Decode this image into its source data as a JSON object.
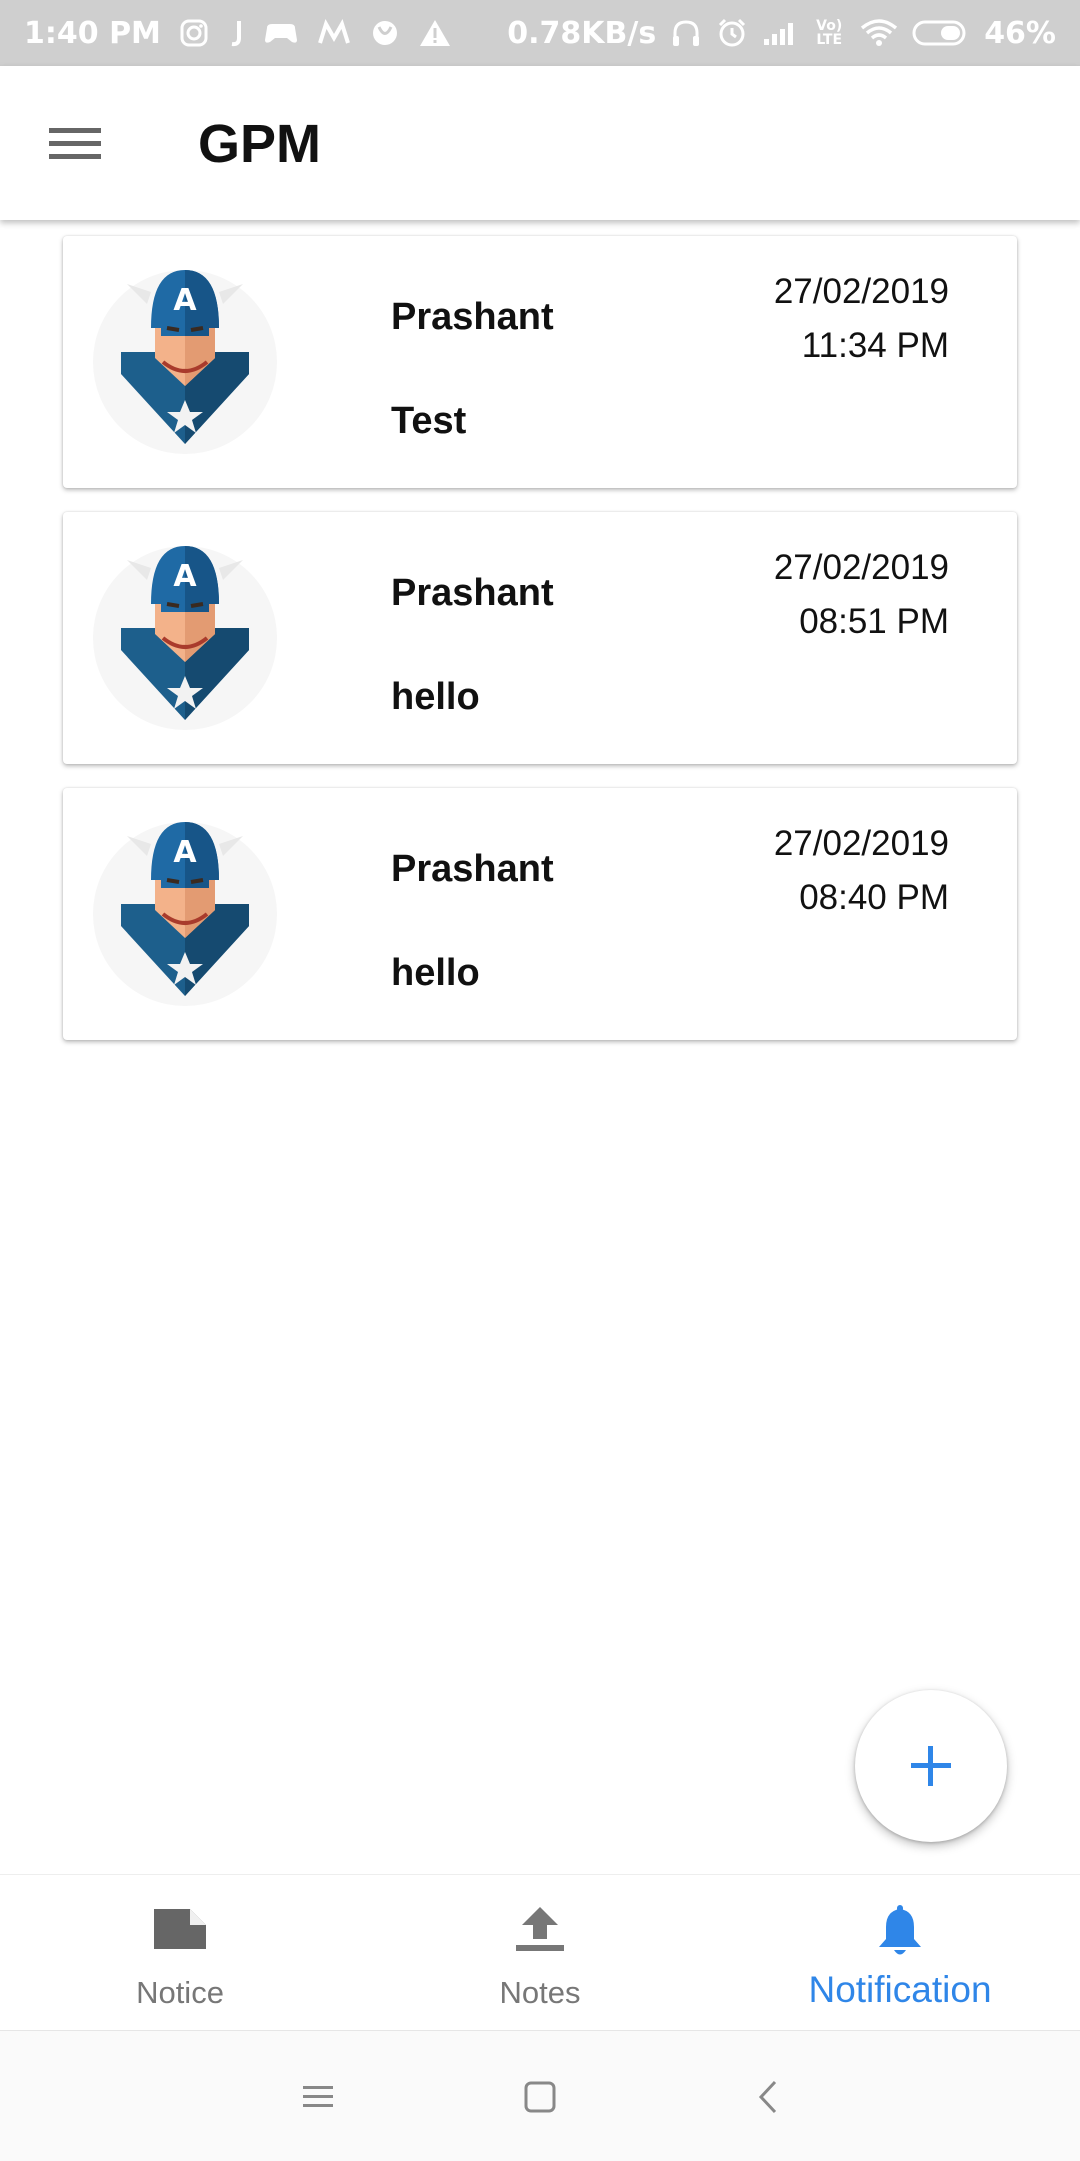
{
  "status_bar": {
    "time": "1:40 PM",
    "net_speed": "0.78KB/s",
    "volte": "Vo) LTE",
    "battery": "46%"
  },
  "app_bar": {
    "title": "GPM",
    "menu_icon": "hamburger-menu-icon"
  },
  "notifications": [
    {
      "sender": "Prashant",
      "message": "Test",
      "date": "27/02/2019",
      "time": "11:34 PM"
    },
    {
      "sender": "Prashant",
      "message": "hello",
      "date": "27/02/2019",
      "time": "08:51 PM"
    },
    {
      "sender": "Prashant",
      "message": "hello",
      "date": "27/02/2019",
      "time": "08:40 PM"
    }
  ],
  "fab": {
    "icon": "plus-icon"
  },
  "bottom_nav": {
    "items": [
      {
        "label": "Notice",
        "icon": "notice-icon",
        "active": false
      },
      {
        "label": "Notes",
        "icon": "upload-icon",
        "active": false
      },
      {
        "label": "Notification",
        "icon": "bell-icon",
        "active": true
      }
    ]
  },
  "colors": {
    "accent": "#2f86e8",
    "inactive": "#777777",
    "status_bar": "#cfcfcf"
  }
}
